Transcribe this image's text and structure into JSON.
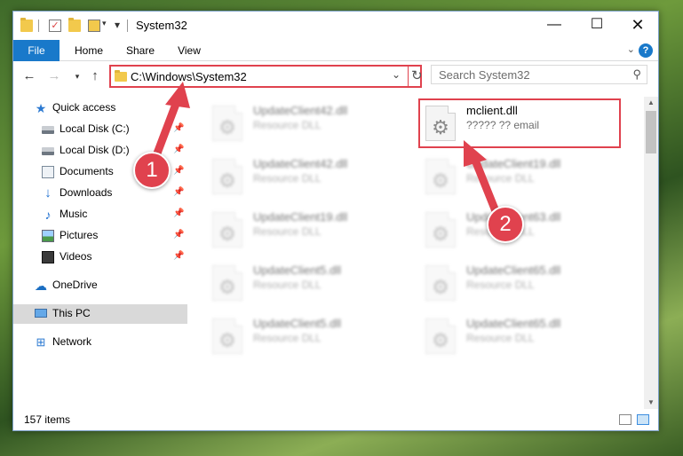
{
  "titlebar": {
    "title": "System32",
    "minimize_icon": "minimize-icon",
    "maximize_icon": "maximize-icon",
    "close_icon": "close-icon"
  },
  "ribbon": {
    "tabs": [
      {
        "label": "File"
      },
      {
        "label": "Home"
      },
      {
        "label": "Share"
      },
      {
        "label": "View"
      }
    ],
    "accent": "#1979ca"
  },
  "navigation": {
    "address": "C:\\Windows\\System32",
    "search_placeholder": "Search System32"
  },
  "sidebar": {
    "items": [
      {
        "label": "Quick access",
        "icon": "star-icon",
        "pinned": false
      },
      {
        "label": "Local Disk (C:)",
        "icon": "drive-icon",
        "pinned": true
      },
      {
        "label": "Local Disk (D:)",
        "icon": "drive-icon",
        "pinned": true
      },
      {
        "label": "Documents",
        "icon": "documents-icon",
        "pinned": true
      },
      {
        "label": "Downloads",
        "icon": "downloads-icon",
        "pinned": true
      },
      {
        "label": "Music",
        "icon": "music-icon",
        "pinned": true
      },
      {
        "label": "Pictures",
        "icon": "pictures-icon",
        "pinned": true
      },
      {
        "label": "Videos",
        "icon": "videos-icon",
        "pinned": true
      },
      {
        "label": "OneDrive",
        "icon": "onedrive-icon",
        "pinned": false
      },
      {
        "label": "This PC",
        "icon": "this-pc-icon",
        "pinned": false,
        "selected": true
      },
      {
        "label": "Network",
        "icon": "network-icon",
        "pinned": false
      }
    ]
  },
  "files": {
    "left_column": [
      {
        "name": "UpdateClient42.dll",
        "type": "Resource DLL"
      },
      {
        "name": "UpdateClient42.dll",
        "type": "Resource DLL"
      },
      {
        "name": "UpdateClient19.dll",
        "type": "Resource DLL"
      },
      {
        "name": "UpdateClient5.dll",
        "type": "Resource DLL"
      },
      {
        "name": "UpdateClient5.dll",
        "type": "Resource DLL"
      }
    ],
    "right_column": [
      {
        "name": "mclient.dll",
        "type": "????? ?? email",
        "highlighted": true
      },
      {
        "name": "UpdateClient19.dll",
        "type": "Resource DLL"
      },
      {
        "name": "UpdateClient63.dll",
        "type": "Resource DLL"
      },
      {
        "name": "UpdateClient65.dll",
        "type": "Resource DLL"
      },
      {
        "name": "UpdateClient65.dll",
        "type": "Resource DLL"
      }
    ]
  },
  "status": {
    "item_count": "157 items"
  },
  "annotations": {
    "badge_1": "1",
    "badge_2": "2",
    "color": "#e0424e"
  }
}
